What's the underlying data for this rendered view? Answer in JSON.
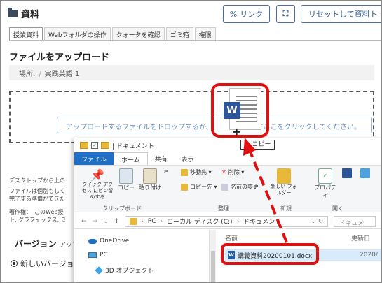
{
  "header": {
    "title": "資料",
    "link_button": "リンク",
    "reset_button": "リセットして資料ト",
    "link_icon": "%"
  },
  "tabs": [
    "授業資料",
    "Webフォルダの操作",
    "クォータを確認",
    "ゴミ箱",
    "権限"
  ],
  "upload": {
    "title": "ファイルをアップロード",
    "location_label": "場所:",
    "location_value": "実践英語 1",
    "drop_text": "アップロードするファイルをドロップするか、",
    "drop_text_end": "にここをクリックしてください。"
  },
  "notes": [
    "デスクトップから上の",
    "ファイルは個別もしく",
    "完了する準備ができた",
    "著作権：　このWeb授",
    "ト, グラフィックス, ミ"
  ],
  "version": {
    "title": "バージョン",
    "suffix": "アップ",
    "new_version": "新しいバージョン"
  },
  "explorer": {
    "titlebar_text": "| ドキュメント",
    "tabs": [
      "ファイル",
      "ホーム",
      "共有",
      "表示"
    ],
    "ribbon": {
      "pin_label": "クイック アクセス にピン留めする",
      "copy_label": "コピー",
      "paste_label": "貼り付け",
      "clipboard_group": "クリップボード",
      "move_to": "移動先 ▾",
      "copy_to": "コピー先 ▾",
      "delete": "削除 ▾",
      "rename": "名前の変更",
      "organize_group": "整理",
      "new_folder": "新しい フォルダー",
      "new_group": "新規",
      "properties": "プロパティ",
      "open_group": "開く"
    },
    "address": {
      "path": [
        "PC",
        "ローカル ディスク (C:)",
        "ドキュメント"
      ],
      "search_placeholder": "ドキュメ"
    },
    "nav": [
      "OneDrive",
      "PC",
      "3D オブジェクト"
    ],
    "columns": [
      "名前",
      "更新日"
    ],
    "file": {
      "name": "講義資料20200101.docx",
      "date": "2020/"
    }
  },
  "drag": {
    "copy_tooltip": "+ コピー",
    "doc_letter": "W"
  },
  "colors": {
    "highlight": "#e01010",
    "accent": "#2d5a8e",
    "word": "#2b579a"
  }
}
